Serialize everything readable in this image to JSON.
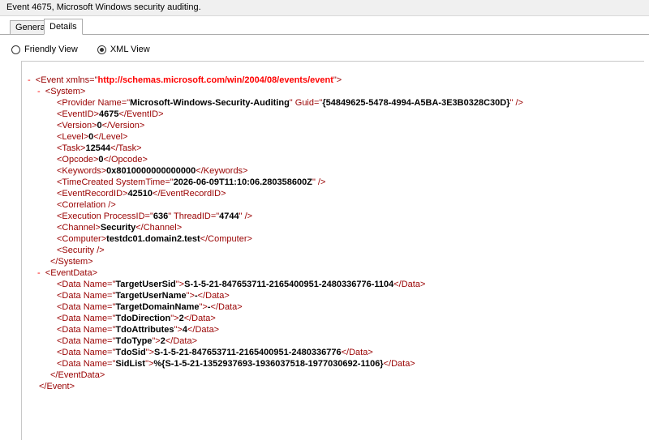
{
  "window": {
    "title": "Event 4675, Microsoft Windows security auditing."
  },
  "tabs": [
    {
      "label": "General"
    },
    {
      "label": "Details"
    }
  ],
  "view_options": {
    "friendly": "Friendly View",
    "xml": "XML View",
    "selected": "XML View"
  },
  "xml": {
    "toggle": "-",
    "event_open": "Event xmlns",
    "event_ns": "http://schemas.microsoft.com/win/2004/08/events/event",
    "system": "System",
    "provider_name": "Microsoft-Windows-Security-Auditing",
    "provider_guid": "{54849625-5478-4994-A5BA-3E3B0328C30D}",
    "event_id": "4675",
    "version": "0",
    "level": "0",
    "task": "12544",
    "opcode": "0",
    "keywords": "0x8010000000000000",
    "time_created": "2026-06-09T11:10:06.280358600Z",
    "event_record_id": "42510",
    "process_id": "636",
    "thread_id": "4744",
    "channel": "Security",
    "computer": "testdc01.domain2.test",
    "event_data": "EventData",
    "data": [
      {
        "name": "TargetUserSid",
        "value": "S-1-5-21-847653711-2165400951-2480336776-1104"
      },
      {
        "name": "TargetUserName",
        "value": "-"
      },
      {
        "name": "TargetDomainName",
        "value": "-"
      },
      {
        "name": "TdoDirection",
        "value": "2"
      },
      {
        "name": "TdoAttributes",
        "value": "4"
      },
      {
        "name": "TdoType",
        "value": "2"
      },
      {
        "name": "TdoSid",
        "value": "S-1-5-21-847653711-2165400951-2480336776"
      },
      {
        "name": "SidList",
        "value": "%{S-1-5-21-1352937693-1936037518-1977030692-1106}"
      }
    ]
  }
}
